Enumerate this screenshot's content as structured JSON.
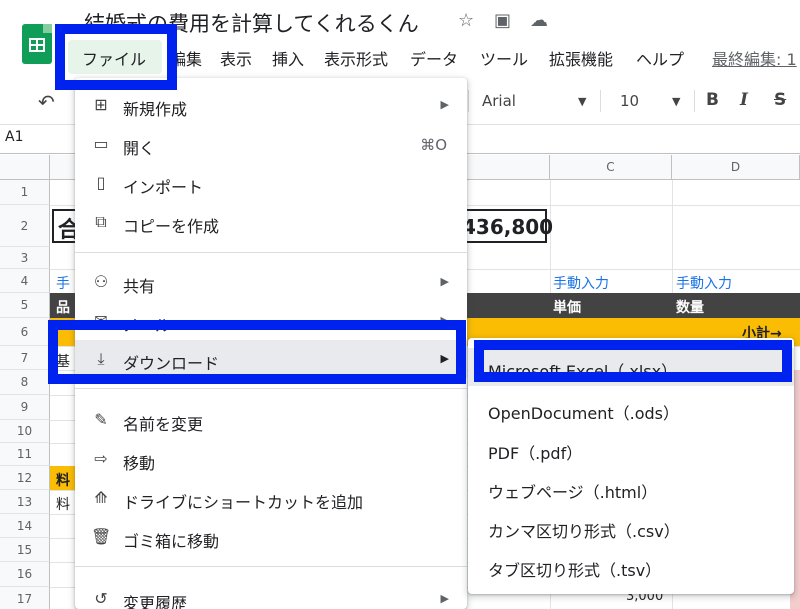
{
  "app": {
    "title": "結婚式の費用を計算してくれるくん",
    "icons": [
      "star-icon",
      "move-to-folder-icon",
      "cloud-status-icon"
    ]
  },
  "menubar": {
    "items": [
      "ファイル",
      "編集",
      "表示",
      "挿入",
      "表示形式",
      "データ",
      "ツール",
      "拡張機能",
      "ヘルプ"
    ],
    "last_edit": "最終編集: 1"
  },
  "toolbar": {
    "undo_icon": "↶",
    "font": "Arial",
    "font_size": "10",
    "bold": "B",
    "italic": "I",
    "strike": "S"
  },
  "formula_bar": {
    "cell_ref": "A1"
  },
  "sheet": {
    "columns": [
      "C",
      "D"
    ],
    "rows": [
      "1",
      "2",
      "3",
      "4",
      "5",
      "6",
      "7",
      "8",
      "9",
      "10",
      "11",
      "12",
      "13",
      "14",
      "15",
      "16",
      "17"
    ],
    "cells": {
      "a2_fragment": "合",
      "total_fragment": "436,800",
      "a4_fragment": "手",
      "c4": "手動入力",
      "d4": "手動入力",
      "a5_fragment": "品",
      "c5": "単価",
      "d5": "数量",
      "a6_fragment": "",
      "d6": "小計→",
      "a7_fragment": "基",
      "a12_fragment": "料",
      "a13_fragment": "料",
      "c16_fragment": "3,000"
    }
  },
  "file_menu": {
    "items": [
      {
        "icon": "⊞",
        "label": "新規作成",
        "arrow": "▶"
      },
      {
        "icon": "▭",
        "label": "開く",
        "shortcut": "⌘O"
      },
      {
        "icon": "▯",
        "label": "インポート"
      },
      {
        "icon": "⧉",
        "label": "コピーを作成"
      },
      {
        "icon": "⚇",
        "label": "共有",
        "arrow": "▶"
      },
      {
        "icon": "✉",
        "label": "メール",
        "arrow": "▶"
      },
      {
        "icon": "⤓",
        "label": "ダウンロード",
        "arrow": "▶"
      },
      {
        "icon": "✎",
        "label": "名前を変更"
      },
      {
        "icon": "⇨",
        "label": "移動"
      },
      {
        "icon": "⟰",
        "label": "ドライブにショートカットを追加"
      },
      {
        "icon": "🗑",
        "label": "ゴミ箱に移動"
      },
      {
        "icon": "↺",
        "label": "変更履歴",
        "arrow": "▶"
      }
    ]
  },
  "download_submenu": {
    "items": [
      "Microsoft Excel（.xlsx）",
      "OpenDocument（.ods）",
      "PDF（.pdf）",
      "ウェブページ（.html）",
      "カンマ区切り形式（.csv）",
      "タブ区切り形式（.tsv）"
    ]
  },
  "colors": {
    "highlight_border": "#0022ee",
    "header_dark": "#434343",
    "accent_orange": "#fbbc04",
    "link_blue": "#1a73e8"
  }
}
